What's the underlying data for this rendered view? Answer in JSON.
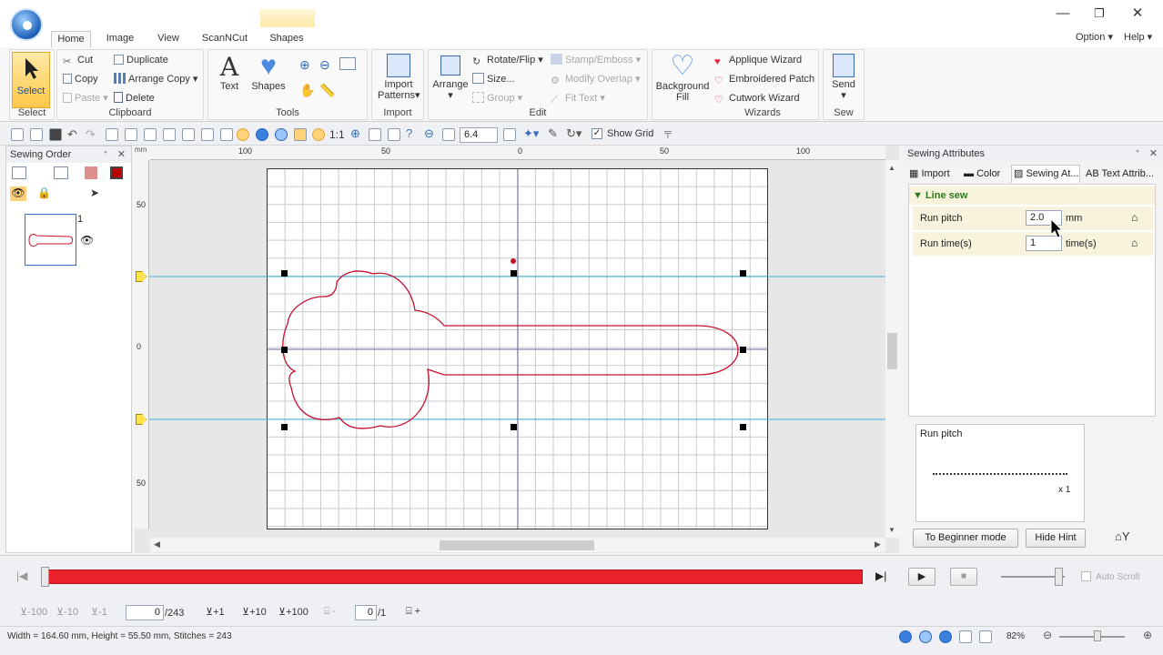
{
  "window": {
    "tabs": [
      "Home",
      "Image",
      "View",
      "ScanNCut",
      "Shapes"
    ],
    "active_tab": "Home",
    "option_label": "Option",
    "help_label": "Help",
    "minimize": "—",
    "maximize": "❐",
    "close": "✕"
  },
  "ribbon": {
    "select": {
      "label": "Select",
      "group": "Select"
    },
    "clipboard": {
      "group": "Clipboard",
      "cut": "Cut",
      "copy": "Copy",
      "paste": "Paste",
      "duplicate": "Duplicate",
      "arrange_copy": "Arrange Copy",
      "delete": "Delete"
    },
    "tools": {
      "group": "Tools",
      "text": "Text",
      "shapes": "Shapes"
    },
    "import": {
      "group": "Import",
      "import_patterns_1": "Import",
      "import_patterns_2": "Patterns"
    },
    "edit": {
      "group": "Edit",
      "arrange": "Arrange",
      "rotate_flip": "Rotate/Flip",
      "size": "Size...",
      "group_btn": "Group",
      "stamp_emboss": "Stamp/Emboss",
      "modify_overlap": "Modify Overlap",
      "fit_text": "Fit Text"
    },
    "fill": {
      "bg1": "Background",
      "bg2": "Fill"
    },
    "wizards": {
      "group": "Wizards",
      "applique": "Applique Wizard",
      "patch": "Embroidered Patch",
      "cutwork": "Cutwork Wizard"
    },
    "sew": {
      "group": "Sew",
      "send": "Send"
    }
  },
  "toolbar": {
    "ratio": "1:1",
    "zoom_value": "6.4",
    "show_grid": "Show Grid"
  },
  "sewing_order": {
    "title": "Sewing Order",
    "item_number": "1"
  },
  "rulers": {
    "h": [
      "100",
      "50",
      "0",
      "50",
      "100"
    ],
    "v": [
      "50",
      "0",
      "50"
    ]
  },
  "sewing_attributes": {
    "title": "Sewing Attributes",
    "tabs": [
      "Import",
      "Color",
      "Sewing At...",
      "Text Attrib..."
    ],
    "section": "Line sew",
    "rows": [
      {
        "label": "Run pitch",
        "value": "2.0",
        "unit": "mm"
      },
      {
        "label": "Run time(s)",
        "value": "1",
        "unit": "time(s)"
      }
    ],
    "hint_title": "Run pitch",
    "hint_caption": "x 1",
    "beginner_btn": "To Beginner mode",
    "hide_hint_btn": "Hide Hint"
  },
  "playback": {
    "auto_scroll": "Auto Scroll",
    "slider_level": 0.85
  },
  "steps": {
    "minus100": "-100",
    "minus10": "-10",
    "minus1": "-1",
    "current": "0",
    "total": "/243",
    "plus1": "+1",
    "plus10": "+10",
    "plus100": "+100",
    "sub": "-",
    "page_current": "0",
    "page_total": "/1",
    "plus": "+"
  },
  "status": {
    "info": "Width = 164.60 mm, Height = 55.50 mm, Stitches = 243",
    "zoom": "82%"
  },
  "colors": {
    "accent": "#2b6cd4",
    "stitch_line": "#c8102e",
    "guide": "#3cb4d8",
    "progress": "#e8212b"
  }
}
